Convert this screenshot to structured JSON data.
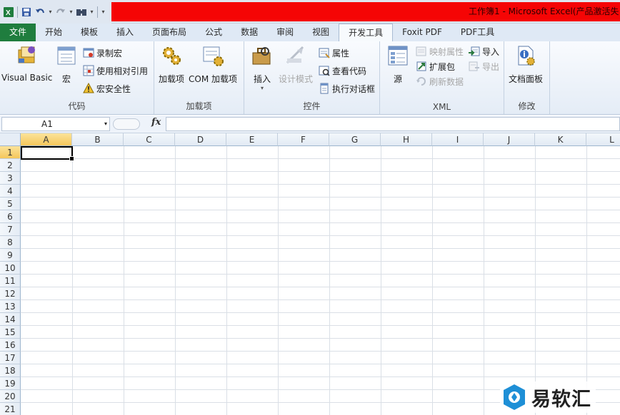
{
  "app": {
    "title": "工作簿1 - Microsoft Excel(产品激活失",
    "title_color": "#f50505",
    "file_tab_color": "#1f7d3e"
  },
  "qat": {
    "icons": [
      "excel-logo-icon",
      "save-icon",
      "undo-icon",
      "redo-icon",
      "find-icon",
      "customize-qat-icon"
    ]
  },
  "tabs": [
    {
      "label": "文件"
    },
    {
      "label": "开始"
    },
    {
      "label": "模板"
    },
    {
      "label": "插入"
    },
    {
      "label": "页面布局"
    },
    {
      "label": "公式"
    },
    {
      "label": "数据"
    },
    {
      "label": "审阅"
    },
    {
      "label": "视图"
    },
    {
      "label": "开发工具",
      "active": true
    },
    {
      "label": "Foxit PDF"
    },
    {
      "label": "PDF工具"
    }
  ],
  "ribbon": {
    "code": {
      "label": "代码",
      "visual_basic": "Visual Basic",
      "macros": "宏",
      "record_macro": "录制宏",
      "relative_ref": "使用相对引用",
      "macro_security": "宏安全性"
    },
    "addins": {
      "label": "加载项",
      "addins": "加载项",
      "com_addins": "COM 加载项"
    },
    "controls": {
      "label": "控件",
      "insert": "插入",
      "design_mode": "设计模式",
      "properties": "属性",
      "view_code": "查看代码",
      "run_dialog": "执行对话框"
    },
    "xml": {
      "label": "XML",
      "source": "源",
      "map_properties": "映射属性",
      "expansion_packs": "扩展包",
      "refresh_data": "刷新数据",
      "import": "导入",
      "export": "导出"
    },
    "modify": {
      "label": "修改",
      "document_panel": "文档面板"
    }
  },
  "formula_bar": {
    "name_box": "A1",
    "fx": "fx",
    "formula": ""
  },
  "sheet": {
    "columns": [
      "A",
      "B",
      "C",
      "D",
      "E",
      "F",
      "G",
      "H",
      "I",
      "J",
      "K",
      "L"
    ],
    "rows": [
      "1",
      "2",
      "3",
      "4",
      "5",
      "6",
      "7",
      "8",
      "9",
      "10",
      "11",
      "12",
      "13",
      "14",
      "15",
      "16",
      "17",
      "18",
      "19",
      "20",
      "21"
    ],
    "active_cell": "A1"
  },
  "watermark": {
    "text": "易软汇"
  }
}
